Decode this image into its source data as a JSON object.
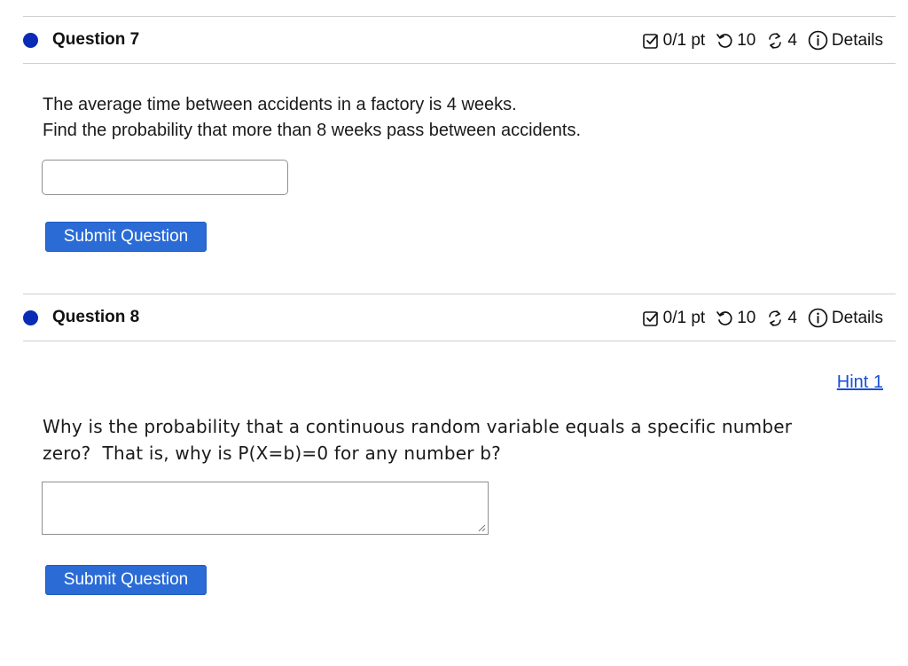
{
  "questions": [
    {
      "title": "Question 7",
      "score": "0/1 pt",
      "retries": "10",
      "versions": "4",
      "details_label": "Details",
      "text_lines": [
        "The average time between accidents in a factory is 4 weeks.",
        "Find the probability that more than 8 weeks pass between accidents."
      ],
      "answer_value": "",
      "submit_label": "Submit Question"
    },
    {
      "title": "Question 8",
      "score": "0/1 pt",
      "retries": "10",
      "versions": "4",
      "details_label": "Details",
      "hint_label": "Hint 1",
      "text_lines": [
        "Why is the probability that a continuous random variable equals a specific number",
        "zero?  That is, why is P(X=b)=0 for any number b?"
      ],
      "answer_value": "",
      "submit_label": "Submit Question"
    }
  ],
  "colors": {
    "status_dot": "#0a2bb5",
    "button_bg": "#2a6bd6",
    "link": "#1a4fd6"
  },
  "icons": [
    "checkbox-score-icon",
    "retry-icon",
    "versions-icon",
    "info-icon"
  ]
}
